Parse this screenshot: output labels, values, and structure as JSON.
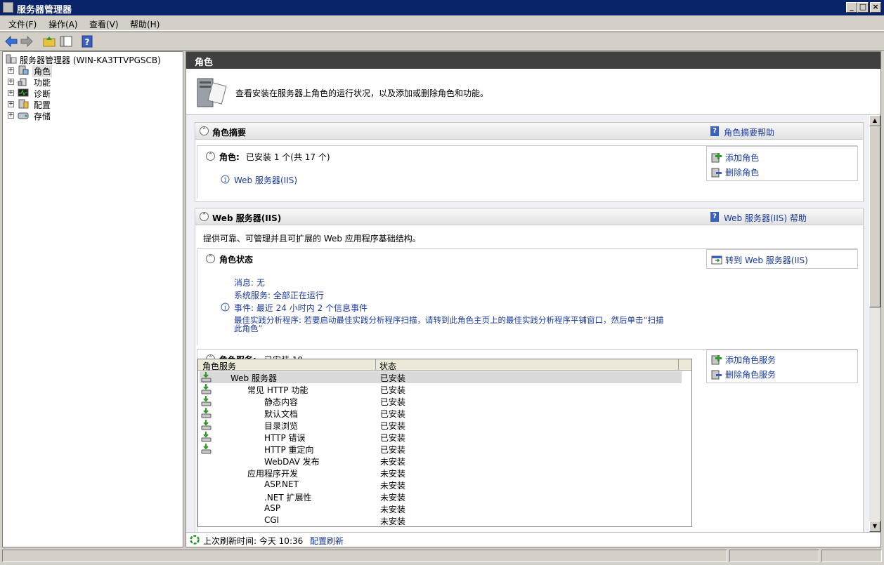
{
  "window": {
    "title": "服务器管理器"
  },
  "menu": [
    "文件(F)",
    "操作(A)",
    "查看(V)",
    "帮助(H)"
  ],
  "tree": {
    "root": "服务器管理器 (WIN-KA3TTVPGSCB)",
    "items": [
      "角色",
      "功能",
      "诊断",
      "配置",
      "存储"
    ]
  },
  "right": {
    "header": "角色",
    "intro": "查看安装在服务器上角色的运行状况，以及添加或删除角色和功能。",
    "summary": {
      "title": "角色摘要",
      "help": "角色摘要帮助",
      "roles_label": "角色:",
      "roles_value": "已安装 1 个(共 17 个)",
      "role_link": "Web 服务器(IIS)",
      "add_role": "添加角色",
      "remove_role": "删除角色"
    },
    "web": {
      "title": "Web 服务器(IIS)",
      "help": "Web 服务器(IIS) 帮助",
      "desc": "提供可靠、可管理并且可扩展的 Web 应用程序基础结构。",
      "status_title": "角色状态",
      "goto": "转到 Web 服务器(IIS)",
      "messages": "消息: 无",
      "services_status": "系统服务: 全部正在运行",
      "events": "事件: 最近 24 小时内 2 个信息事件",
      "bpa_line1": "最佳实践分析程序: 若要启动最佳实践分析程序扫描，请转到此角色主页上的最佳实践分析程序平铺窗口，然后单击“扫描",
      "bpa_line2": "此角色”",
      "services_title": "角色服务:",
      "services_value": "已安装 19",
      "add_service": "添加角色服务",
      "remove_service": "删除角色服务",
      "table": {
        "col1": "角色服务",
        "col2": "状态",
        "rows": [
          {
            "name": "Web 服务器",
            "status": "已安装",
            "level": 0,
            "installed": true
          },
          {
            "name": "常见 HTTP 功能",
            "status": "已安装",
            "level": 1,
            "installed": true
          },
          {
            "name": "静态内容",
            "status": "已安装",
            "level": 2,
            "installed": true
          },
          {
            "name": "默认文档",
            "status": "已安装",
            "level": 2,
            "installed": true
          },
          {
            "name": "目录浏览",
            "status": "已安装",
            "level": 2,
            "installed": true
          },
          {
            "name": "HTTP 错误",
            "status": "已安装",
            "level": 2,
            "installed": true
          },
          {
            "name": "HTTP 重定向",
            "status": "已安装",
            "level": 2,
            "installed": true
          },
          {
            "name": "WebDAV 发布",
            "status": "未安装",
            "level": 2,
            "installed": false
          },
          {
            "name": "应用程序开发",
            "status": "未安装",
            "level": 1,
            "installed": false
          },
          {
            "name": "ASP.NET",
            "status": "未安装",
            "level": 2,
            "installed": false
          },
          {
            "name": ".NET 扩展性",
            "status": "未安装",
            "level": 2,
            "installed": false
          },
          {
            "name": "ASP",
            "status": "未安装",
            "level": 2,
            "installed": false
          },
          {
            "name": "CGI",
            "status": "未安装",
            "level": 2,
            "installed": false
          }
        ]
      }
    },
    "footer": {
      "refresh_label": "上次刷新时间: 今天 10:36",
      "configure_refresh": "配置刷新"
    }
  }
}
